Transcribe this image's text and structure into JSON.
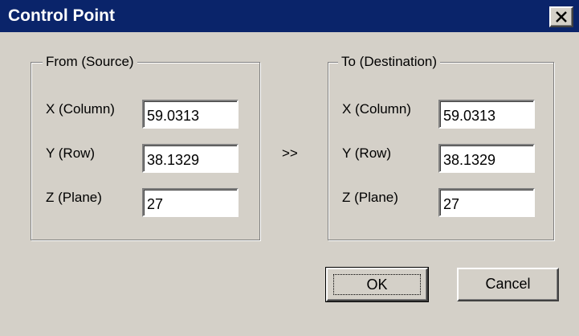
{
  "window": {
    "title": "Control Point",
    "close_glyph": "close-icon"
  },
  "source_group": {
    "legend": "From (Source)",
    "x_label": "X (Column)",
    "y_label": "Y (Row)",
    "z_label": "Z (Plane)",
    "x_value": "59.0313",
    "y_value": "38.1329",
    "z_value": "27"
  },
  "copy_arrow": ">>",
  "dest_group": {
    "legend": "To (Destination)",
    "x_label": "X (Column)",
    "y_label": "Y (Row)",
    "z_label": "Z (Plane)",
    "x_value": "59.0313",
    "y_value": "38.1329",
    "z_value": "27"
  },
  "buttons": {
    "ok_label": "OK",
    "cancel_label": "Cancel"
  }
}
